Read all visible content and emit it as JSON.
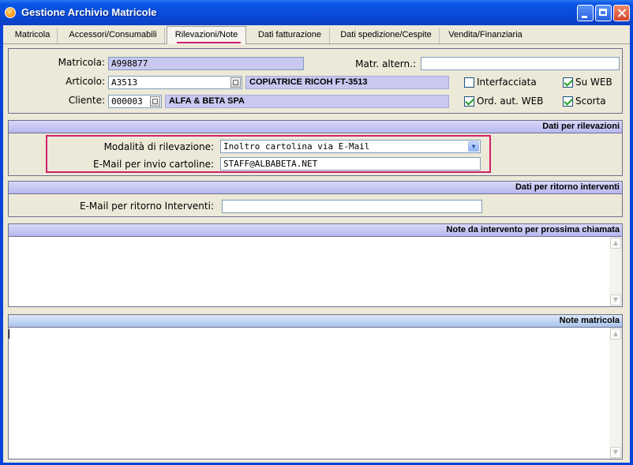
{
  "window": {
    "title": "Gestione Archivio Matricole",
    "buttons": {
      "minimize": "minimize-icon",
      "maximize": "maximize-icon",
      "close": "close-icon"
    }
  },
  "tabs": [
    {
      "label": "Matricola"
    },
    {
      "label": "Accessori/Consumabili"
    },
    {
      "label": "Rilevazioni/Note",
      "active": true
    },
    {
      "label": "Dati fatturazione"
    },
    {
      "label": "Dati spedizione/Cespite"
    },
    {
      "label": "Vendita/Finanziaria"
    }
  ],
  "header": {
    "matricola_label": "Matricola:",
    "matricola_value": "A998877",
    "matr_altern_label": "Matr. altern.:",
    "matr_altern_value": "",
    "articolo_label": "Articolo:",
    "articolo_value": "A3513",
    "articolo_desc": "COPIATRICE RICOH FT-3513",
    "cliente_label": "Cliente:",
    "cliente_value": "000003",
    "cliente_desc": "ALFA & BETA SPA",
    "checkboxes": {
      "interfacciata": {
        "label": "Interfacciata",
        "checked": false
      },
      "su_web": {
        "label": "Su WEB",
        "checked": true
      },
      "ord_aut_web": {
        "label": "Ord. aut. WEB",
        "checked": true
      },
      "scorta": {
        "label": "Scorta",
        "checked": true
      }
    }
  },
  "rilevazioni": {
    "heading": "Dati per rilevazioni",
    "modalita_label": "Modalità di rilevazione:",
    "modalita_value": "Inoltro cartolina via E-Mail",
    "email_label": "E-Mail per invio cartoline:",
    "email_value": "STAFF@ALBABETA.NET"
  },
  "ritorno": {
    "heading": "Dati per ritorno interventi",
    "email_label": "E-Mail per ritorno Interventi:",
    "email_value": ""
  },
  "note_intervento": {
    "heading": "Note da intervento per prossima chiamata",
    "text": ""
  },
  "note_matricola": {
    "heading": "Note matricola",
    "text": ""
  },
  "colors": {
    "titlebar": "#0a4ad8",
    "readonly_field": "#c8c8f0",
    "highlight": "#d0206a",
    "panel": "#ece9d8"
  }
}
